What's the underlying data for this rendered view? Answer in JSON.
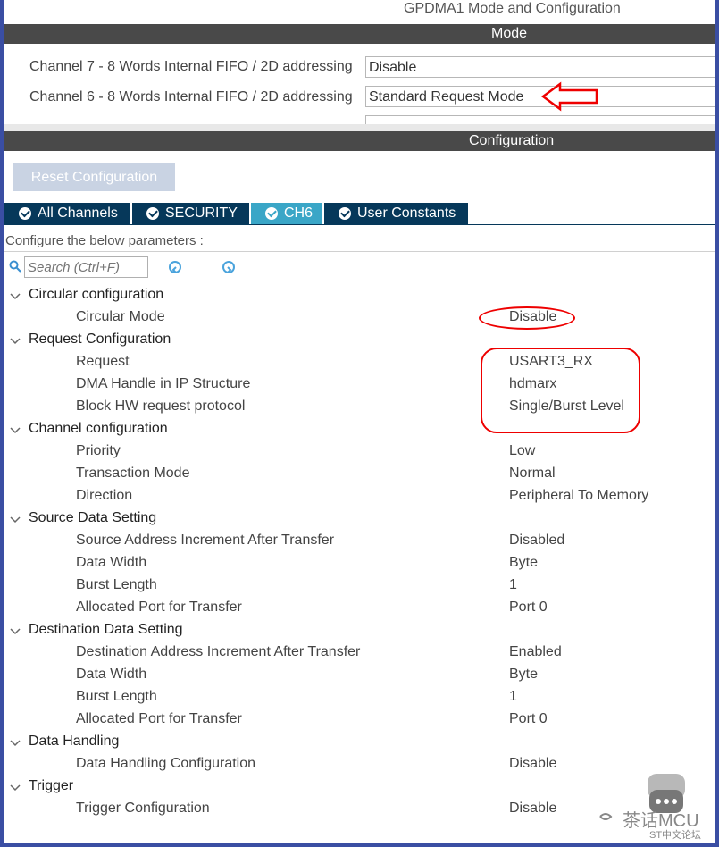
{
  "window_title": "GPDMA1 Mode and Configuration",
  "mode_section": {
    "header": "Mode",
    "rows": [
      {
        "label": "Channel 7  - 8 Words Internal FIFO / 2D addressing",
        "value": "Disable"
      },
      {
        "label": "Channel 6  - 8 Words Internal FIFO / 2D addressing",
        "value": "Standard Request Mode"
      }
    ]
  },
  "config_section": {
    "header": "Configuration",
    "reset_button": "Reset Configuration",
    "tabs": [
      {
        "label": "All Channels",
        "active": false
      },
      {
        "label": "SECURITY",
        "active": false
      },
      {
        "label": "CH6",
        "active": true
      },
      {
        "label": "User Constants",
        "active": false
      }
    ],
    "configure_label": "Configure the below parameters :",
    "search_placeholder": "Search (Ctrl+F)"
  },
  "tree": [
    {
      "group": "Circular configuration",
      "params": [
        {
          "name": "Circular Mode",
          "value": "Disable"
        }
      ]
    },
    {
      "group": "Request Configuration",
      "params": [
        {
          "name": "Request",
          "value": "USART3_RX"
        },
        {
          "name": "DMA Handle in IP Structure",
          "value": "hdmarx"
        },
        {
          "name": "Block HW request protocol",
          "value": "Single/Burst Level"
        }
      ]
    },
    {
      "group": "Channel configuration",
      "params": [
        {
          "name": "Priority",
          "value": "Low"
        },
        {
          "name": "Transaction Mode",
          "value": "Normal"
        },
        {
          "name": "Direction",
          "value": "Peripheral To Memory"
        }
      ]
    },
    {
      "group": "Source Data Setting",
      "params": [
        {
          "name": "Source Address Increment After Transfer",
          "value": "Disabled"
        },
        {
          "name": "Data Width",
          "value": "Byte"
        },
        {
          "name": "Burst Length",
          "value": "1"
        },
        {
          "name": "Allocated Port for Transfer",
          "value": "Port 0"
        }
      ]
    },
    {
      "group": "Destination Data Setting",
      "params": [
        {
          "name": "Destination Address Increment After Transfer",
          "value": "Enabled"
        },
        {
          "name": "Data Width",
          "value": "Byte"
        },
        {
          "name": "Burst Length",
          "value": "1"
        },
        {
          "name": "Allocated Port for Transfer",
          "value": "Port 0"
        }
      ]
    },
    {
      "group": "Data Handling",
      "params": [
        {
          "name": "Data Handling Configuration",
          "value": "Disable"
        }
      ]
    },
    {
      "group": "Trigger",
      "params": [
        {
          "name": "Trigger Configuration",
          "value": "Disable"
        }
      ]
    }
  ],
  "watermark": {
    "title": "茶话MCU",
    "subtitle": "ST中文论坛"
  },
  "colors": {
    "header_bar": "#494949",
    "tab_bg": "#06385a",
    "tab_active": "#3aa6c7",
    "annotation": "#ee0000",
    "frame": "#3a4ea3"
  }
}
